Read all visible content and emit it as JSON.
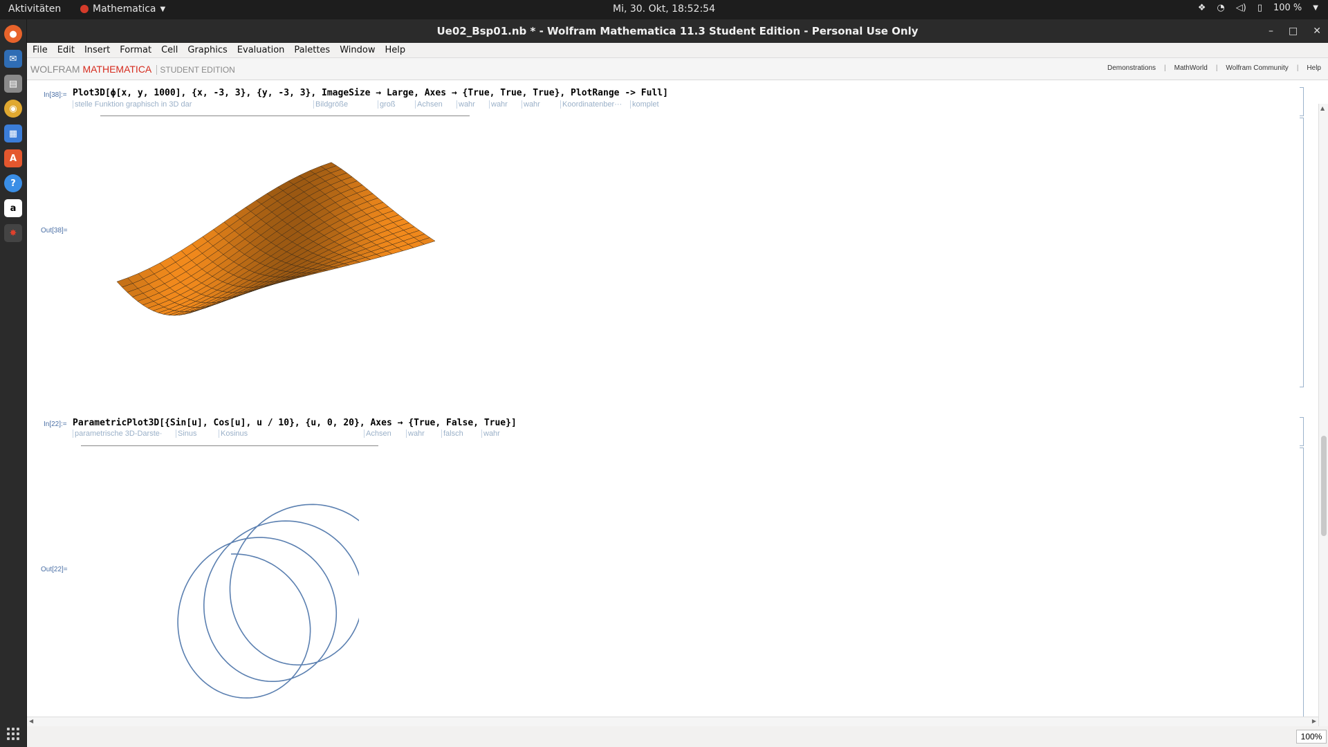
{
  "topbar": {
    "activities": "Aktivitäten",
    "app_name": "Mathematica",
    "clock": "Mi, 30. Okt, 18:52:54",
    "battery": "100 %"
  },
  "window": {
    "title": "Ue02_Bsp01.nb * - Wolfram Mathematica 11.3 Student Edition - Personal Use Only"
  },
  "menu": [
    "File",
    "Edit",
    "Insert",
    "Format",
    "Cell",
    "Graphics",
    "Evaluation",
    "Palettes",
    "Window",
    "Help"
  ],
  "brand": {
    "wolfram": "WOLFRAM",
    "mathematica": "MATHEMATICA",
    "edition": "STUDENT EDITION",
    "links": [
      "Demonstrations",
      "MathWorld",
      "Wolfram Community",
      "Help"
    ]
  },
  "cells": [
    {
      "in_label": "In[38]:=",
      "out_label": "Out[38]=",
      "input": "Plot3D[ϕ[x, y, 1000], {x, -3, 3}, {y, -3, 3}, ImageSize → Large, Axes → {True, True, True}, PlotRange -> Full]",
      "hints": [
        "stelle Funktion graphisch in 3D dar",
        "Bildgröße",
        "groß",
        "Achsen",
        "wahr",
        "wahr",
        "wahr",
        "Koordinatenber···",
        "komplet"
      ],
      "surface_color": "#f28a1c"
    },
    {
      "in_label": "In[22]:=",
      "out_label": "Out[22]=",
      "input": "ParametricPlot3D[{Sin[u], Cos[u], u / 10}, {u, 0, 20}, Axes → {True, False, True}]",
      "hints": [
        "parametrische 3D-Darste·",
        "Sinus",
        "Kosinus",
        "Achsen",
        "wahr",
        "falsch",
        "wahr"
      ],
      "curve_color": "#5a7fb0"
    }
  ],
  "statusbar": {
    "zoom": "100%"
  }
}
